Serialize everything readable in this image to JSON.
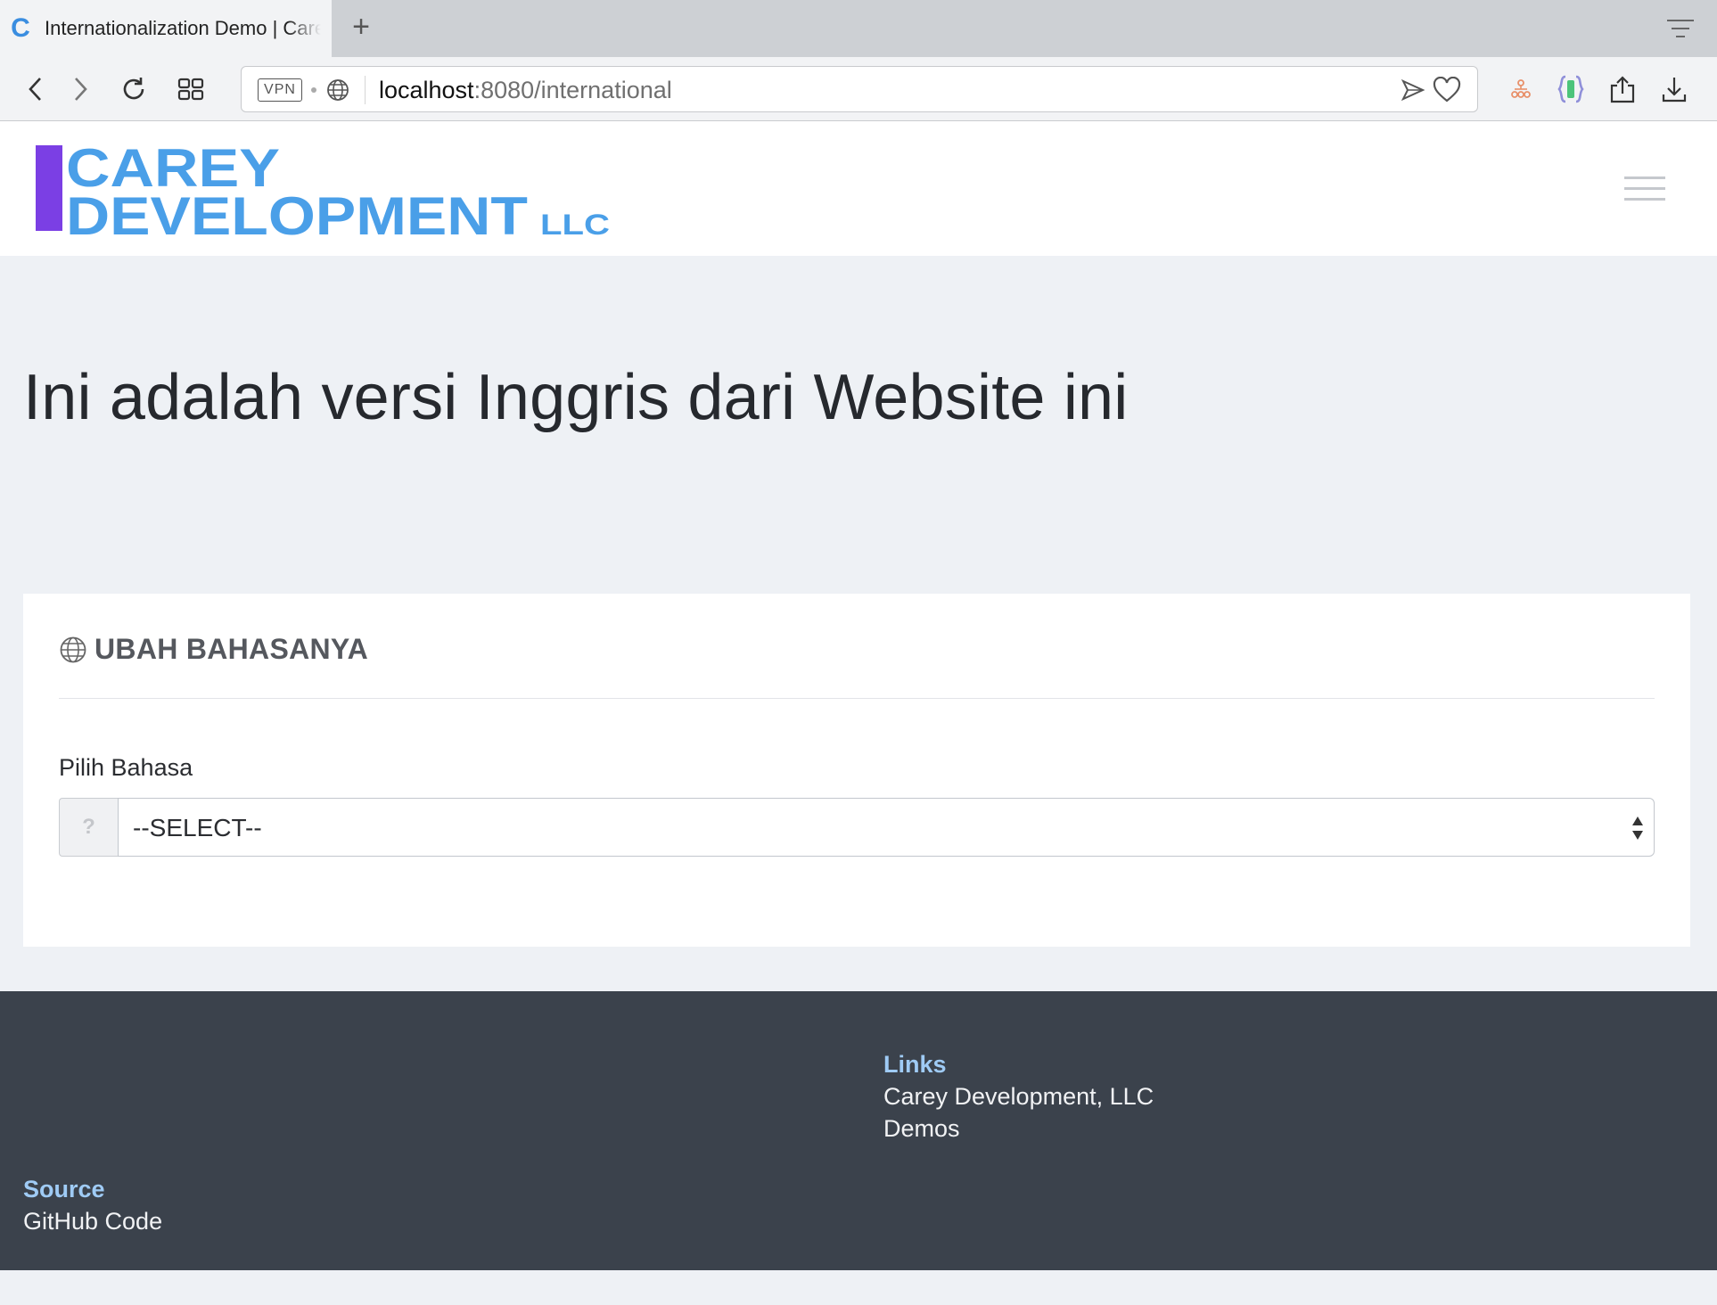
{
  "browser": {
    "tab": {
      "favicon": "C",
      "title": "Internationalization Demo | Carey Development"
    },
    "new_tab_label": "+",
    "vpn_label": "VPN",
    "address": {
      "host": "localhost",
      "rest": ":8080/international"
    },
    "icons": [
      "back-icon",
      "forward-icon",
      "reload-icon",
      "speed-dial-icon",
      "globe-icon",
      "send-icon",
      "heart-icon",
      "sitemap-icon",
      "extension-icon",
      "share-icon",
      "download-icon",
      "tab-menu-icon"
    ]
  },
  "site": {
    "logo": {
      "line1": "CAREY",
      "line2": "DEVELOPMENT",
      "suffix": "LLC",
      "colors": {
        "bar": "#7b3fe4",
        "text": "#4a9fe8"
      }
    },
    "menu_icon": "hamburger-icon"
  },
  "hero": {
    "title": "Ini adalah versi Inggris dari Website ini"
  },
  "language_card": {
    "icon": "globe-icon",
    "title": "UBAH BAHASANYA",
    "field_label": "Pilih Bahasa",
    "addon": "?",
    "select_value": "--SELECT--"
  },
  "footer": {
    "links_heading": "Links",
    "links": [
      "Carey Development, LLC",
      "Demos"
    ],
    "source_heading": "Source",
    "source_link": "GitHub Code",
    "colors": {
      "background": "#3b424c",
      "heading": "#9fcbf5"
    }
  }
}
